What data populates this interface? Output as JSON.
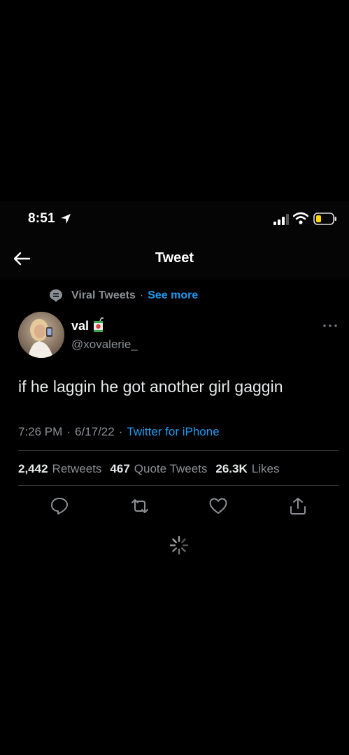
{
  "status_bar": {
    "time": "8:51",
    "icons": [
      "location-arrow-icon",
      "cellular-signal-icon",
      "wifi-icon",
      "battery-low-icon"
    ],
    "battery_color": "#ffd60a"
  },
  "header": {
    "title": "Tweet",
    "back_icon": "arrow-left-icon"
  },
  "context": {
    "icon": "topic-icon",
    "label": "Viral Tweets",
    "separator": "·",
    "link": "See more"
  },
  "author": {
    "name": "val",
    "emoji_icon": "juice-box-icon",
    "handle": "@xovalerie_",
    "avatar": "avatar"
  },
  "tweet": {
    "text": "if he laggin he got another girl gaggin",
    "time": "7:26 PM",
    "separator": "·",
    "date": "6/17/22",
    "source": "Twitter for iPhone"
  },
  "stats": [
    {
      "value": "2,442",
      "label": "Retweets"
    },
    {
      "value": "467",
      "label": "Quote Tweets"
    },
    {
      "value": "26.3K",
      "label": "Likes"
    }
  ],
  "actions": [
    "reply-icon",
    "retweet-icon",
    "like-icon",
    "share-icon"
  ],
  "colors": {
    "background": "#000000",
    "accent": "#1d9bf0",
    "secondary_text": "#8b8f94",
    "primary_text": "#e7e9ea",
    "divider": "#2f3336"
  }
}
